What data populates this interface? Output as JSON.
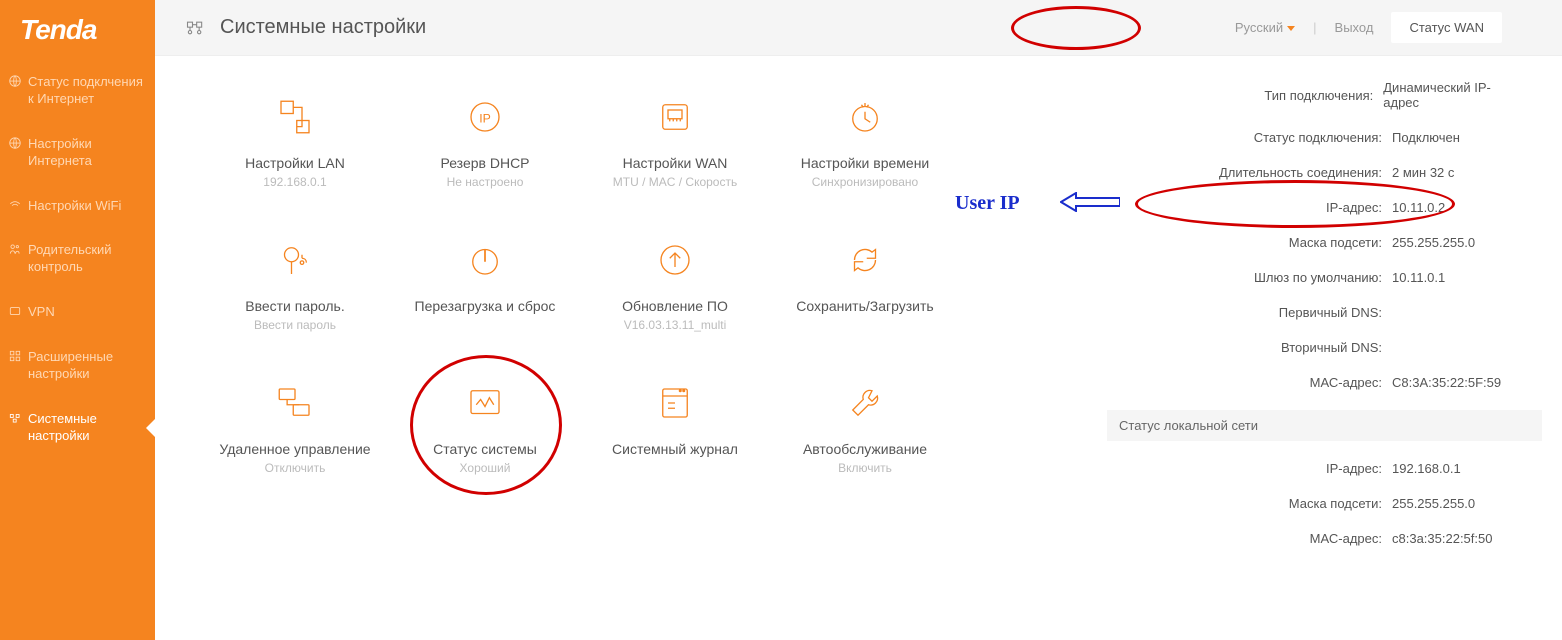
{
  "brand": "Tenda",
  "sidebar": {
    "items": [
      {
        "label": "Статус подклчения к Интернет"
      },
      {
        "label": "Настройки Интернета"
      },
      {
        "label": "Настройки WiFi"
      },
      {
        "label": "Родительский контроль"
      },
      {
        "label": "VPN"
      },
      {
        "label": "Расширенные настройки"
      },
      {
        "label": "Системные настройки"
      }
    ]
  },
  "header": {
    "title": "Системные настройки",
    "language": "Русский",
    "logout": "Выход",
    "tab_wan": "Статус WAN"
  },
  "tiles": [
    {
      "title": "Настройки LAN",
      "sub": "192.168.0.1"
    },
    {
      "title": "Резерв DHCP",
      "sub": "Не настроено"
    },
    {
      "title": "Настройки WAN",
      "sub": "MTU / MAC / Скорость"
    },
    {
      "title": "Настройки времени",
      "sub": "Синхронизировано"
    },
    {
      "title": "Ввести пароль.",
      "sub": "Ввести пароль"
    },
    {
      "title": "Перезагрузка и сброс",
      "sub": ""
    },
    {
      "title": "Обновление ПО",
      "sub": "V16.03.13.11_multi"
    },
    {
      "title": "Сохранить/Загрузить",
      "sub": ""
    },
    {
      "title": "Удаленное управление",
      "sub": "Отключить"
    },
    {
      "title": "Статус системы",
      "sub": "Хороший"
    },
    {
      "title": "Системный журнал",
      "sub": ""
    },
    {
      "title": "Автообслуживание",
      "sub": "Включить"
    }
  ],
  "wan": {
    "rows": [
      {
        "k": "Тип подключения:",
        "v": "Динамический IP-адрес"
      },
      {
        "k": "Статус подключения:",
        "v": "Подключен"
      },
      {
        "k": "Длительность соединения:",
        "v": "2 мин 32 с"
      },
      {
        "k": "IP-адрес:",
        "v": "10.11.0.2"
      },
      {
        "k": "Маска подсети:",
        "v": "255.255.255.0"
      },
      {
        "k": "Шлюз по умолчанию:",
        "v": "10.11.0.1"
      },
      {
        "k": "Первичный DNS:",
        "v": ""
      },
      {
        "k": "Вторичный DNS:",
        "v": ""
      },
      {
        "k": "МАС-адрес:",
        "v": "C8:3A:35:22:5F:59"
      }
    ],
    "lan_header": "Статус локальной сети",
    "lan_rows": [
      {
        "k": "IP-адрес:",
        "v": "192.168.0.1"
      },
      {
        "k": "Маска подсети:",
        "v": "255.255.255.0"
      },
      {
        "k": "МАС-адрес:",
        "v": "c8:3a:35:22:5f:50"
      }
    ]
  },
  "annotation": {
    "user_ip": "User IP"
  }
}
